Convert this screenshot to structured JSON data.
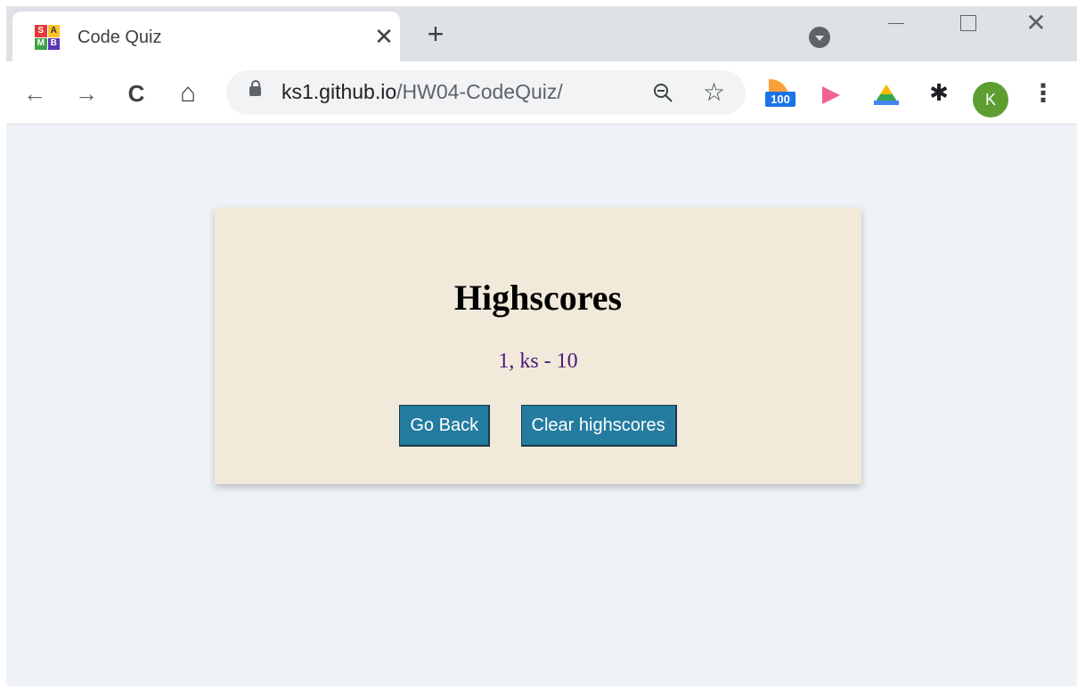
{
  "browser": {
    "tab": {
      "title": "Code Quiz",
      "favicon_letters": [
        "S",
        "A",
        "M",
        "B"
      ],
      "close_glyph": "✕"
    },
    "new_tab_glyph": "+",
    "window": {
      "close_glyph": "✕"
    },
    "toolbar": {
      "back_glyph": "←",
      "forward_glyph": "→",
      "reload_glyph": "C",
      "home_glyph": "⌂",
      "url_host": "ks1.github.io",
      "url_path": "/HW04-CodeQuiz/",
      "star_glyph": "☆",
      "feed_badge": "100",
      "puzzle_glyph": "✱",
      "avatar_letter": "K",
      "menu_glyph": "⋮"
    }
  },
  "page": {
    "heading": "Highscores",
    "scores": [
      "1, ks - 10"
    ],
    "go_back_label": "Go Back",
    "clear_label": "Clear highscores"
  },
  "colors": {
    "card_bg": "#f1e9d9",
    "page_bg": "#eff3f7",
    "button_bg": "#247ba0",
    "score_text": "#4b1a7a"
  },
  "icons": [
    "favicon-icon",
    "close-icon",
    "plus-icon",
    "tab-search-icon",
    "back-arrow-icon",
    "forward-arrow-icon",
    "reload-icon",
    "home-icon",
    "lock-icon",
    "zoom-out-icon",
    "star-icon",
    "rss-feed-extension-icon",
    "video-extension-icon",
    "drive-extension-icon",
    "puzzle-icon",
    "avatar",
    "more-menu-icon"
  ]
}
